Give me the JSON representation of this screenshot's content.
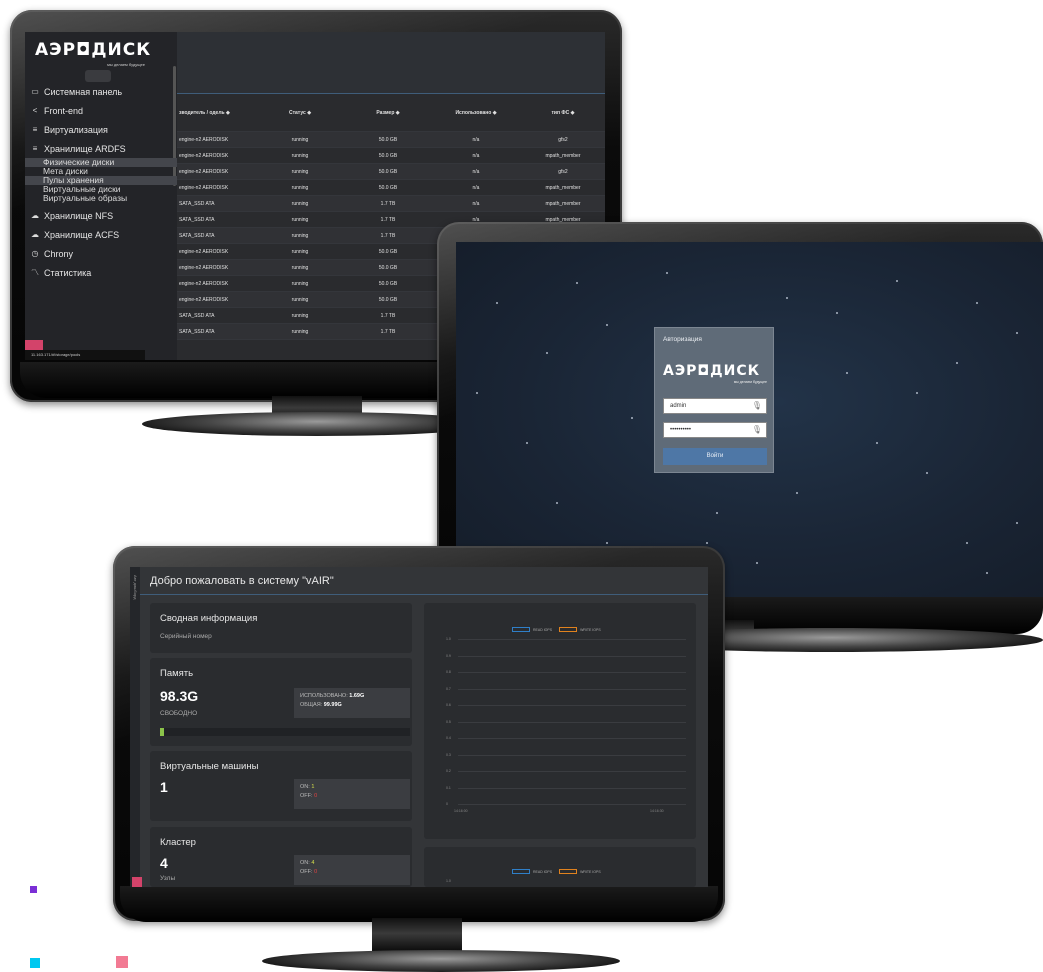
{
  "accent": {
    "blue": "#3f5d7a",
    "green": "#8bc34a",
    "red": "#e34343",
    "yellow": "#d6e04a",
    "pink": "#d3436a",
    "teal": "#00c8f0",
    "purple": "#7b2fd6"
  },
  "ardfs": {
    "logo_word": "АЭР◘ДИСК",
    "logo_tag": "мы делаем будущее",
    "nav": [
      {
        "icon": "monitor-icon",
        "label": "Системная панель"
      },
      {
        "icon": "share-icon",
        "label": "Front-end"
      },
      {
        "icon": "database-icon",
        "label": "Виртуализация"
      },
      {
        "icon": "database-icon",
        "label": "Хранилище ARDFS"
      }
    ],
    "subnav": [
      {
        "label": "Физические диски",
        "active": true
      },
      {
        "label": "Мета диски",
        "active": false
      },
      {
        "label": "Пулы хранения",
        "active": true
      },
      {
        "label": "Виртуальные диски",
        "active": false
      },
      {
        "label": "Виртуальные образы",
        "active": false
      }
    ],
    "nav2": [
      {
        "icon": "cloud-icon",
        "label": "Хранилище NFS"
      },
      {
        "icon": "cloud-icon",
        "label": "Хранилище ACFS"
      },
      {
        "icon": "clock-icon",
        "label": "Chrony"
      },
      {
        "icon": "chart-icon",
        "label": "Статистика"
      }
    ],
    "table": {
      "headers": [
        "зводитель /\nодель",
        "Статус",
        "Размер",
        "Использовано",
        "тип ФС"
      ],
      "rows": [
        [
          "engine-n2 AERODISK",
          "running",
          "50.0 GB",
          "n/a",
          "gfs2"
        ],
        [
          "engine-n2 AERODISK",
          "running",
          "50.0 GB",
          "n/a",
          "mpath_member"
        ],
        [
          "engine-n2 AERODISK",
          "running",
          "50.0 GB",
          "n/a",
          "gfs2"
        ],
        [
          "engine-n2 AERODISK",
          "running",
          "50.0 GB",
          "n/a",
          "mpath_member"
        ],
        [
          "SATA_SSD ATA",
          "running",
          "1.7 TB",
          "n/a",
          "mpath_member"
        ],
        [
          "SATA_SSD ATA",
          "running",
          "1.7 TB",
          "n/a",
          "mpath_member"
        ],
        [
          "SATA_SSD ATA",
          "running",
          "1.7 TB",
          "",
          ""
        ],
        [
          "engine-n2 AERODISK",
          "running",
          "50.0 GB",
          "",
          ""
        ],
        [
          "engine-n2 AERODISK",
          "running",
          "50.0 GB",
          "",
          ""
        ],
        [
          "engine-n2 AERODISK",
          "running",
          "50.0 GB",
          "",
          ""
        ],
        [
          "engine-n2 AERODISK",
          "running",
          "50.0 GB",
          "",
          ""
        ],
        [
          "SATA_SSD ATA",
          "running",
          "1.7 TB",
          "",
          ""
        ],
        [
          "SATA_SSD ATA",
          "running",
          "1.7 TB",
          "",
          ""
        ]
      ]
    },
    "footer_url": "11.163.171/#!/storage/pools"
  },
  "login": {
    "title": "Авторизация",
    "logo_word": "АЭР◘ДИСК",
    "logo_tag": "мы делаем будущее",
    "username_value": "admin",
    "password_value": "••••••••••",
    "submit_label": "Войти"
  },
  "vair": {
    "rail_text": "Авт дашборд",
    "title": "Добро пожаловать в систему \"vAIR\"",
    "summary": {
      "heading": "Сводная информация",
      "subtitle": "Серийный номер"
    },
    "memory": {
      "heading": "Память",
      "free_value": "98.3G",
      "free_label": "СВОБОДНО",
      "used_label": "ИСПОЛЬЗОВАНО:",
      "used_value": "1.69G",
      "total_label": "ОБЩАЯ:",
      "total_value": "99.99G",
      "used_fraction": 0.017
    },
    "vms": {
      "heading": "Виртуальные машины",
      "count": "1",
      "on_label": "ON:",
      "on_value": "1",
      "off_label": "OFF:",
      "off_value": "0"
    },
    "cluster": {
      "heading": "Кластер",
      "count": "4",
      "sub": "Узлы",
      "on_label": "ON:",
      "on_value": "4",
      "off_label": "OFF:",
      "off_value": "0"
    },
    "chart1": {
      "legend": [
        "READ IOPS",
        "WRITE IOPS"
      ],
      "yticks": [
        "1.0",
        "0.9",
        "0.8",
        "0.7",
        "0.6",
        "0.5",
        "0.4",
        "0.3",
        "0.2",
        "0.1",
        "0"
      ],
      "xticks": [
        "14:16:00",
        "14:16:30"
      ]
    },
    "chart2": {
      "legend": [
        "READ IOPS",
        "WRITE IOPS"
      ],
      "yticks": [
        "1.0"
      ]
    }
  }
}
